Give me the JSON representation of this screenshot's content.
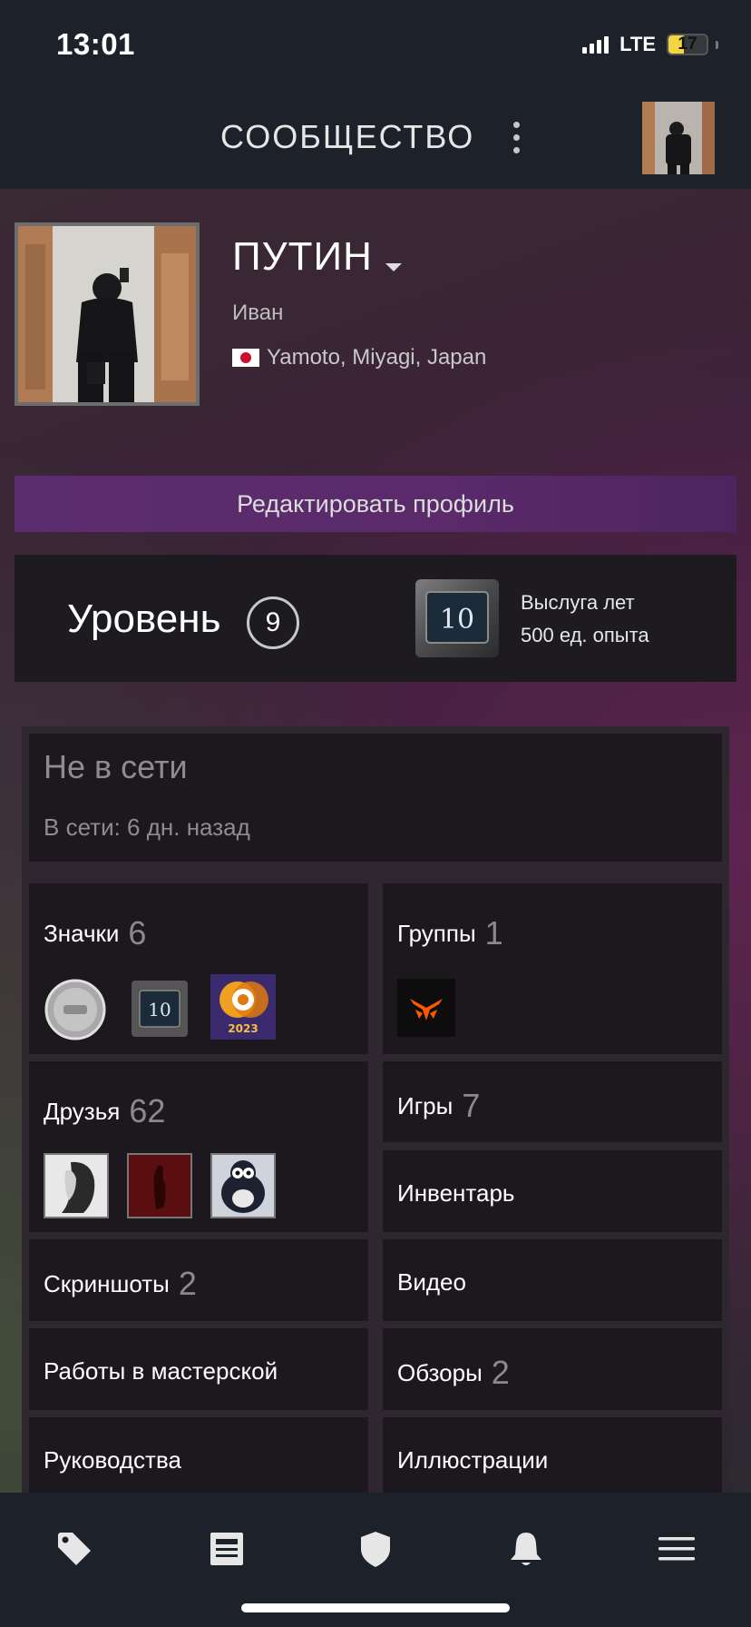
{
  "status_bar": {
    "time": "13:01",
    "network": "LTE",
    "battery": "17"
  },
  "top_nav": {
    "title": "СООБЩЕСТВО"
  },
  "profile": {
    "username": "ПУТИН",
    "real_name": "Иван",
    "location": "Yamoto, Miyagi, Japan",
    "edit_button": "Редактировать профиль"
  },
  "level": {
    "label": "Уровень",
    "value": "9",
    "badge_number": "10",
    "badge_title": "Выслуга лет",
    "badge_xp": "500 ед. опыта"
  },
  "online_status": {
    "state": "Не в сети",
    "last_online": "В сети: 6 дн. назад"
  },
  "stats": {
    "badges": {
      "label": "Значки",
      "count": "6",
      "badge_year": "2023",
      "badge_level": "10"
    },
    "groups": {
      "label": "Группы",
      "count": "1"
    },
    "friends": {
      "label": "Друзья",
      "count": "62"
    },
    "games": {
      "label": "Игры",
      "count": "7"
    },
    "inventory": {
      "label": "Инвентарь"
    },
    "screenshots": {
      "label": "Скриншоты",
      "count": "2"
    },
    "videos": {
      "label": "Видео"
    },
    "workshop": {
      "label": "Работы в мастерской"
    },
    "reviews": {
      "label": "Обзоры",
      "count": "2"
    },
    "guides": {
      "label": "Руководства"
    },
    "artwork": {
      "label": "Иллюстрации"
    }
  },
  "bottom_nav": {
    "icons": [
      "tag-icon",
      "news-icon",
      "shield-icon",
      "bell-icon",
      "menu-icon"
    ]
  },
  "colors": {
    "header_bg": "#1d212a",
    "edit_button": "#5c2d6e",
    "tile_bg": "#1d181d",
    "battery": "#f5d442",
    "groups_logo": "#ff5900"
  }
}
